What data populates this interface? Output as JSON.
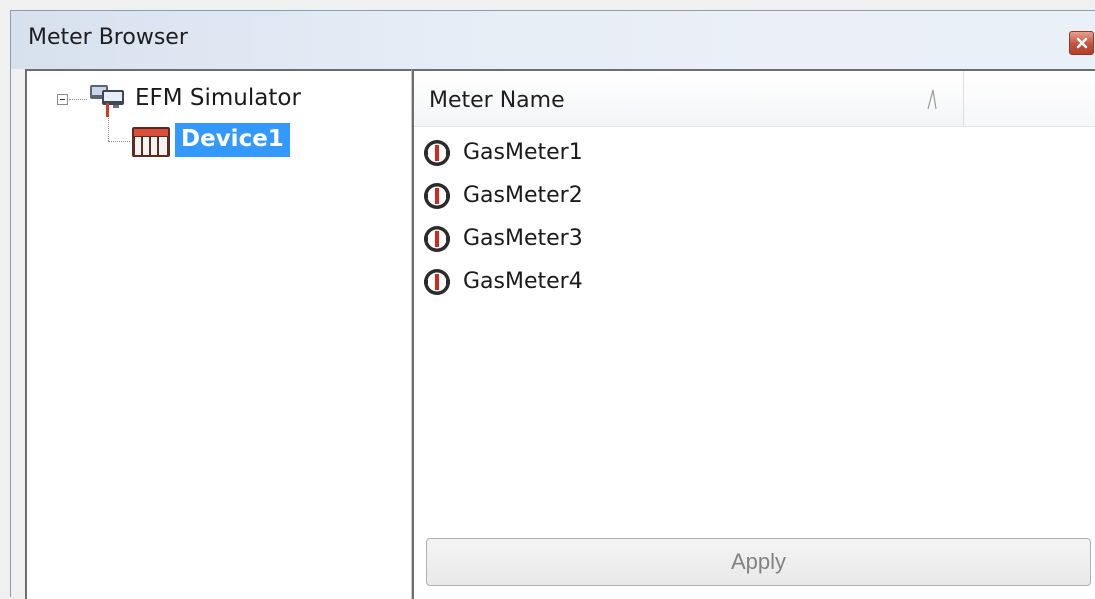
{
  "window": {
    "title": "Meter Browser",
    "close_icon": "close-icon"
  },
  "tree": {
    "root": {
      "label": "EFM Simulator",
      "icon": "computer-network-icon",
      "expanded": true
    },
    "children": [
      {
        "label": "Device1",
        "icon": "device-icon",
        "selected": true
      }
    ]
  },
  "list": {
    "column_header": "Meter Name",
    "sort_icon": "sort-ascending-icon",
    "items": [
      {
        "label": "GasMeter1",
        "icon": "gas-meter-icon"
      },
      {
        "label": "GasMeter2",
        "icon": "gas-meter-icon"
      },
      {
        "label": "GasMeter3",
        "icon": "gas-meter-icon"
      },
      {
        "label": "GasMeter4",
        "icon": "gas-meter-icon"
      }
    ]
  },
  "apply_button": {
    "label": "Apply",
    "enabled": false
  },
  "colors": {
    "selection": "#3399ff",
    "close_button": "#c4533f",
    "disabled_text": "#838383"
  }
}
